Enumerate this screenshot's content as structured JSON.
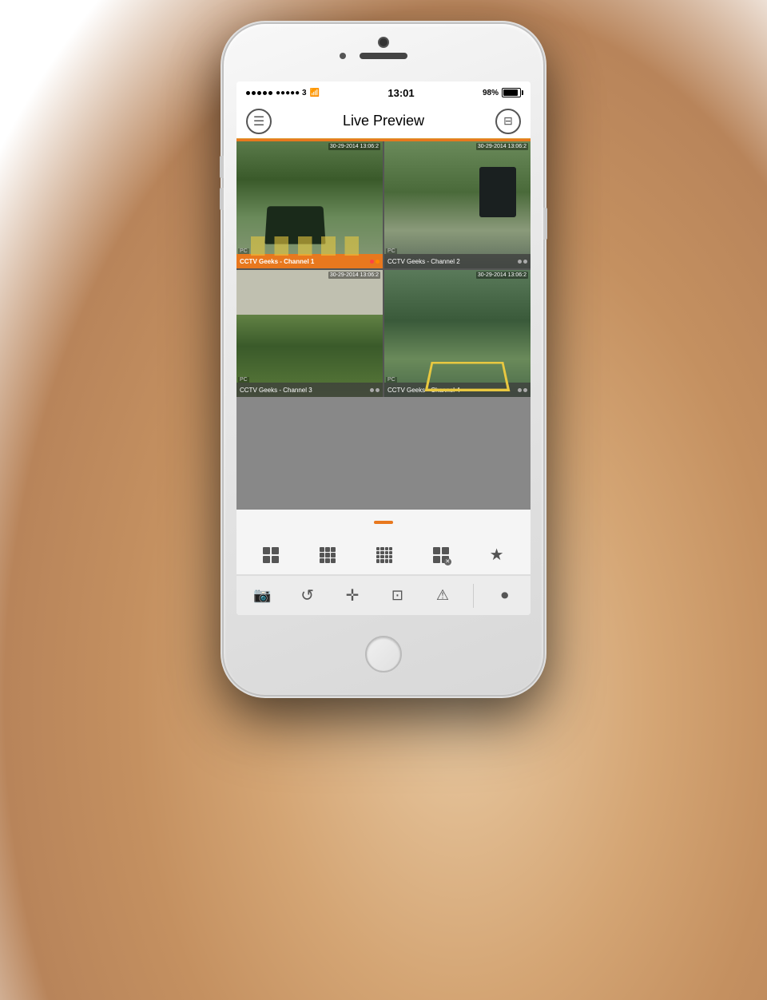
{
  "scene": {
    "background": "hand holding phone"
  },
  "status_bar": {
    "signal": "●●●●● 3",
    "wifi": "WiFi",
    "time": "13:01",
    "battery_percent": "98%",
    "battery_label": "Battery"
  },
  "nav": {
    "title": "Live Preview",
    "menu_icon": "☰",
    "list_icon": "⊞"
  },
  "cameras": [
    {
      "id": "ch1",
      "label": "CCTV Geeks - Channel 1",
      "timestamp": "30-29-2014 13:06:2",
      "pc_label": "PC",
      "active": true,
      "dots": [
        "red",
        "orange"
      ]
    },
    {
      "id": "ch2",
      "label": "CCTV Geeks - Channel 2",
      "timestamp": "30-29-2014 13:06:2",
      "pc_label": "PC",
      "active": false,
      "dots": [
        "grey",
        "grey"
      ]
    },
    {
      "id": "ch3",
      "label": "CCTV Geeks - Channel 3",
      "timestamp": "30-29-2014 13:06:2",
      "pc_label": "PC",
      "active": false,
      "dots": [
        "grey",
        "grey"
      ]
    },
    {
      "id": "ch4",
      "label": "CCTV Geeks - Channel 4",
      "timestamp": "30-29-2014 13:06:2",
      "pc_label": "PC",
      "active": false,
      "dots": [
        "grey",
        "grey"
      ]
    }
  ],
  "grid_controls": {
    "grid_2x2": "2×2",
    "grid_3x3": "3×3",
    "grid_4x4": "4×4",
    "grid_close": "close",
    "favorites": "★"
  },
  "bottom_controls": {
    "snapshot": "📷",
    "playback": "↺",
    "ptz": "✛",
    "display": "🖥",
    "alarm": "⚠",
    "record": "⏺"
  },
  "colors": {
    "orange": "#e8781e",
    "dark_text": "#333333",
    "light_bg": "#f5f5f5",
    "camera_bar_active": "#e8781e",
    "camera_bar_inactive": "rgba(60,60,60,0.75)"
  }
}
